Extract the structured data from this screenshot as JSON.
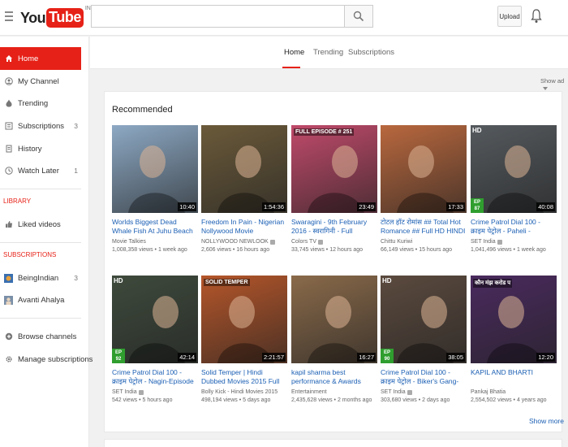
{
  "header": {
    "logo_text_you": "You",
    "logo_text_tube": "Tube",
    "logo_country": "IN",
    "search_placeholder": "",
    "upload_label": "Upload"
  },
  "sidebar": {
    "items": [
      {
        "label": "Home",
        "icon": "home-icon"
      },
      {
        "label": "My Channel",
        "icon": "user-icon"
      },
      {
        "label": "Trending",
        "icon": "flame-icon"
      },
      {
        "label": "Subscriptions",
        "icon": "subscriptions-icon",
        "count": "3"
      },
      {
        "label": "History",
        "icon": "history-icon"
      },
      {
        "label": "Watch Later",
        "icon": "clock-icon",
        "count": "1"
      }
    ],
    "library_heading": "LIBRARY",
    "library_items": [
      {
        "label": "Liked videos",
        "icon": "thumbs-up-icon"
      }
    ],
    "subscriptions_heading": "SUBSCRIPTIONS",
    "subscription_items": [
      {
        "label": "BeingIndian",
        "count": "3"
      },
      {
        "label": "Avanti Ahalya"
      }
    ],
    "footer_items": [
      {
        "label": "Browse channels",
        "icon": "plus-circle-icon"
      },
      {
        "label": "Manage subscriptions",
        "icon": "gear-icon"
      }
    ]
  },
  "tabs": [
    {
      "label": "Home"
    },
    {
      "label": "Trending"
    },
    {
      "label": "Subscriptions"
    }
  ],
  "show_ad_label": "Show ad",
  "section_title": "Recommended",
  "videos": [
    {
      "title": "Worlds Biggest Dead Whale Fish At Juhu Beach Mumbai",
      "channel": "Movie Talkies",
      "views": "1,008,358 views",
      "age": "1 week ago",
      "duration": "10:40",
      "verified": false,
      "thumb_bg": "#8da9c4"
    },
    {
      "title": "Freedom In Pain - Nigerian Nollywood Movie",
      "channel": "NOLLYWOOD NEWLOOK",
      "views": "2,606 views",
      "age": "16 hours ago",
      "duration": "1:54:36",
      "verified": true,
      "thumb_bg": "#6b5a3a"
    },
    {
      "title": "Swaragini - 9th February 2016 - स्वरागिनी - Full Episode (HD)",
      "channel": "Colors TV",
      "views": "33,745 views",
      "age": "12 hours ago",
      "duration": "23:49",
      "verified": true,
      "thumb_bg": "#c04a6a",
      "banner": "FULL EPISODE # 251"
    },
    {
      "title": "टोटल हॉट रोमांस ## Total Hot Romance ## Full HD HINDI",
      "channel": "Chittu Kuriwi",
      "views": "66,149 views",
      "age": "15 hours ago",
      "duration": "17:33",
      "verified": false,
      "thumb_bg": "#b9683e"
    },
    {
      "title": "Crime Patrol Dial 100 - क्राइम पेट्रोल - Paheli - Episode 87 -",
      "channel": "SET India",
      "views": "1,041,496 views",
      "age": "1 week ago",
      "duration": "40:08",
      "verified": true,
      "thumb_bg": "#555a5e",
      "hd": "HD",
      "episode": "EP 87"
    },
    {
      "title": "Crime Patrol Dial 100 - क्राइम पेट्रोल - Nagin-Episode 92 -",
      "channel": "SET India",
      "views": "542 views",
      "age": "5 hours ago",
      "duration": "42:14",
      "verified": true,
      "thumb_bg": "#3e4a3c",
      "hd": "HD",
      "episode": "EP 92"
    },
    {
      "title": "Solid Temper | Hindi Dubbed Movies 2015 Full Movie | | J...",
      "channel": "Bolly Kick - Hindi Movies 2015",
      "views": "498,194 views",
      "age": "5 days ago",
      "duration": "2:21:57",
      "verified": false,
      "thumb_bg": "#b5562a",
      "banner": "SOLID TEMPER"
    },
    {
      "title": "kapil sharma best performance & Awards 2016",
      "channel": "Entertainment",
      "views": "2,435,628 views",
      "age": "2 months ago",
      "duration": "16:27",
      "verified": false,
      "thumb_bg": "#8a6a4a"
    },
    {
      "title": "Crime Patrol Dial 100 - क्राइम पेट्रोल - Biker's Gang- Episode...",
      "channel": "SET India",
      "views": "303,680 views",
      "age": "2 days ago",
      "duration": "38:05",
      "verified": true,
      "thumb_bg": "#5b4a3e",
      "hd": "HD",
      "episode": "EP 90"
    },
    {
      "title": "KAPIL AND BHARTI",
      "channel": "Pankaj Bhatia",
      "views": "2,554,502 views",
      "age": "4 years ago",
      "duration": "12:20",
      "verified": false,
      "thumb_bg": "#4a2a5e",
      "banner": "कौन मंझ करोड प"
    }
  ],
  "show_more_label": "Show more",
  "colors": {
    "accent": "#e62117",
    "link": "#1b5fb4"
  }
}
